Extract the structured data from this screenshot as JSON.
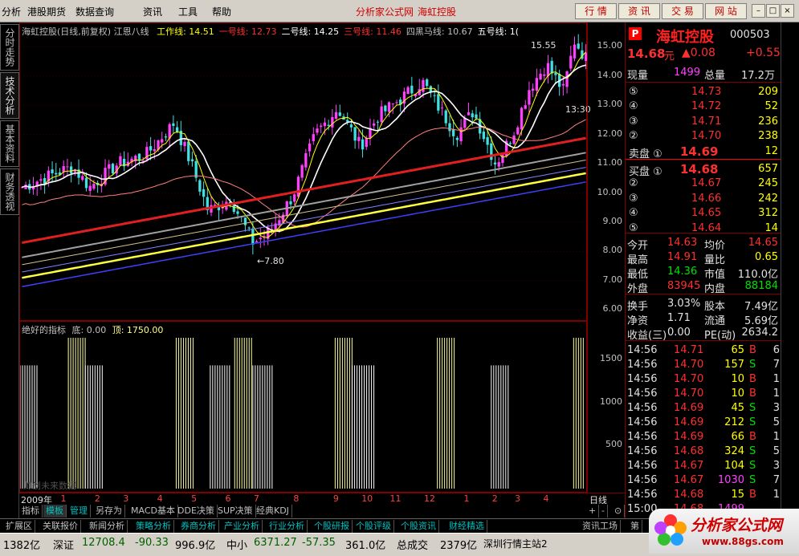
{
  "menu": {
    "items": [
      "分析",
      "港股期货",
      "数据查询",
      "资讯",
      "工具",
      "帮助"
    ],
    "title_site": "分析家公式网",
    "title_stock": "海虹控股",
    "toolbar_buttons": [
      "行 情",
      "资 讯",
      "交 易",
      "网 站"
    ],
    "window_buttons": [
      "–",
      "□",
      "×"
    ]
  },
  "left_tabs": [
    "分时走势",
    "技术分析",
    "基本资料",
    "财务透视"
  ],
  "chart": {
    "legend_title": "海虹控股(日线,前复权) 江恩八线",
    "lines": [
      {
        "name": "工作线",
        "value": "14.51",
        "color": "#ffff00"
      },
      {
        "name": "一号线",
        "value": "12.73",
        "color": "#ff3030"
      },
      {
        "name": "二号线",
        "value": "14.25",
        "color": "#ffffff"
      },
      {
        "name": "三号线",
        "value": "11.46",
        "color": "#ff3030"
      },
      {
        "name": "四黑马线",
        "value": "10.67",
        "color": "#c0c0c0"
      },
      {
        "name": "五号线",
        "value": "1(",
        "color": "#ffffff"
      }
    ],
    "annot_high": "15.55",
    "annot_low": "←7.80",
    "annot_time": "13:30",
    "y_ticks": [
      "15.00",
      "14.00",
      "13.00",
      "12.00",
      "11.00",
      "10.00",
      "9.00",
      "8.00",
      "7.00",
      "6.00"
    ],
    "y_tick_values": [
      15,
      14,
      13,
      12,
      11,
      10,
      9,
      8,
      7,
      6
    ],
    "ylim": [
      5.6,
      15.8
    ]
  },
  "indicator": {
    "title": "绝好的指标",
    "bottom_label": "底: 0.00",
    "top_label": "顶: 1750.00",
    "watermark": "帅创未来数据",
    "y_ticks": [
      "1500",
      "1000",
      "500"
    ],
    "y_tick_values": [
      1500,
      1000,
      500
    ],
    "ylim": [
      0,
      1750
    ],
    "bars": [
      {
        "start": 0.0,
        "end": 0.03,
        "value": 1430
      },
      {
        "start": 0.085,
        "end": 0.115,
        "value": 1750
      },
      {
        "start": 0.115,
        "end": 0.145,
        "value": 1430
      },
      {
        "start": 0.275,
        "end": 0.305,
        "value": 1750
      },
      {
        "start": 0.335,
        "end": 0.37,
        "value": 1430
      },
      {
        "start": 0.378,
        "end": 0.41,
        "value": 1750
      },
      {
        "start": 0.41,
        "end": 0.445,
        "value": 1430
      },
      {
        "start": 0.555,
        "end": 0.585,
        "value": 1750
      },
      {
        "start": 0.585,
        "end": 0.625,
        "value": 1430
      },
      {
        "start": 0.735,
        "end": 0.765,
        "value": 1750
      },
      {
        "start": 0.83,
        "end": 0.86,
        "value": 1430
      },
      {
        "start": 0.975,
        "end": 0.995,
        "value": 1750
      }
    ]
  },
  "date_axis": {
    "labels": [
      {
        "text": "2009年",
        "pos": 0.0
      },
      {
        "text": "1",
        "pos": 0.07
      },
      {
        "text": "2",
        "pos": 0.13
      },
      {
        "text": "3",
        "pos": 0.18
      },
      {
        "text": "4",
        "pos": 0.24
      },
      {
        "text": "5",
        "pos": 0.3
      },
      {
        "text": "6",
        "pos": 0.36
      },
      {
        "text": "7",
        "pos": 0.41
      },
      {
        "text": "8",
        "pos": 0.48
      },
      {
        "text": "9",
        "pos": 0.55
      },
      {
        "text": "10",
        "pos": 0.6
      },
      {
        "text": "11",
        "pos": 0.65
      },
      {
        "text": "12",
        "pos": 0.71
      },
      {
        "text": "1",
        "pos": 0.78
      },
      {
        "text": "2",
        "pos": 0.83
      },
      {
        "text": "3",
        "pos": 0.87
      },
      {
        "text": "4",
        "pos": 0.92
      }
    ],
    "period": "日线"
  },
  "bottom_tabs": [
    "指标",
    "模板",
    "管理",
    "另存为",
    "MACD基本",
    "DDE决策",
    "SUP决策",
    "经典KDJ"
  ],
  "bottom_controls": [
    "+",
    "-",
    "⊙"
  ],
  "shortcuts": [
    "扩展区",
    "关联报价",
    "新闻分析",
    "策略分析",
    "券商分析",
    "产业分析",
    "行业分析",
    "个股研报",
    "个股评级",
    "个股资讯",
    "财经精选",
    "资讯工场",
    "第"
  ],
  "status": {
    "vol1": "1382亿",
    "sz_label": "深证",
    "sz_index": "12708.4",
    "sz_change": "-90.33",
    "sz_amount": "996.9亿",
    "zx_label": "中小",
    "zx_index": "6371.27",
    "zx_change": "-57.35",
    "zx_amount": "361.0亿",
    "total_label": "总成交",
    "total_value": "2379亿",
    "server": "深圳行情主站2"
  },
  "quote": {
    "badge": "P",
    "name": "海虹控股",
    "code": "000503",
    "price": "14.68",
    "unit": "元",
    "change": "▲0.08",
    "change_pct": "+0.55",
    "vol_label": "现量",
    "vol_value": "1499",
    "total_vol_label": "总量",
    "total_vol_value": "17.2万",
    "asks": [
      {
        "lvl": "⑤",
        "price": "14.73",
        "vol": "209"
      },
      {
        "lvl": "④",
        "price": "14.72",
        "vol": "52"
      },
      {
        "lvl": "③",
        "price": "14.71",
        "vol": "236"
      },
      {
        "lvl": "②",
        "price": "14.70",
        "vol": "238"
      },
      {
        "lvl": "卖盘 ①",
        "price": "14.69",
        "vol": "12"
      }
    ],
    "bids": [
      {
        "lvl": "买盘 ①",
        "price": "14.68",
        "vol": "657"
      },
      {
        "lvl": "②",
        "price": "14.67",
        "vol": "245"
      },
      {
        "lvl": "③",
        "price": "14.66",
        "vol": "242"
      },
      {
        "lvl": "④",
        "price": "14.65",
        "vol": "312"
      },
      {
        "lvl": "⑤",
        "price": "14.64",
        "vol": "14"
      }
    ],
    "stats": [
      {
        "l1": "今开",
        "v1": "14.63",
        "c1": "red",
        "l2": "均价",
        "v2": "14.65",
        "c2": "red"
      },
      {
        "l1": "最高",
        "v1": "14.91",
        "c1": "red",
        "l2": "量比",
        "v2": "0.65",
        "c2": "yellow"
      },
      {
        "l1": "最低",
        "v1": "14.36",
        "c1": "green",
        "l2": "市值",
        "v2": "110.0亿",
        "c2": "white"
      },
      {
        "l1": "外盘",
        "v1": "83945",
        "c1": "red",
        "l2": "内盘",
        "v2": "88184",
        "c2": "green"
      }
    ],
    "fund": [
      {
        "l1": "换手",
        "v1": "3.03%",
        "l2": "股本",
        "v2": "7.49亿"
      },
      {
        "l1": "净资",
        "v1": "1.71",
        "l2": "流通",
        "v2": "5.69亿"
      },
      {
        "l1": "收益(三)",
        "v1": "0.00",
        "l2": "PE(动)",
        "v2": "2634.2"
      }
    ],
    "ticks": [
      {
        "t": "14:56",
        "p": "14.71",
        "v": "65",
        "bs": "B",
        "n": "6"
      },
      {
        "t": "14:56",
        "p": "14.70",
        "v": "157",
        "bs": "S",
        "n": "7"
      },
      {
        "t": "14:56",
        "p": "14.70",
        "v": "10",
        "bs": "B",
        "n": "1"
      },
      {
        "t": "14:56",
        "p": "14.70",
        "v": "10",
        "bs": "B",
        "n": "1"
      },
      {
        "t": "14:56",
        "p": "14.69",
        "v": "45",
        "bs": "S",
        "n": "3"
      },
      {
        "t": "14:56",
        "p": "14.69",
        "v": "212",
        "bs": "S",
        "n": "5"
      },
      {
        "t": "14:56",
        "p": "14.69",
        "v": "66",
        "bs": "B",
        "n": "1"
      },
      {
        "t": "14:56",
        "p": "14.68",
        "v": "324",
        "bs": "S",
        "n": "5"
      },
      {
        "t": "14:56",
        "p": "14.67",
        "v": "104",
        "bs": "S",
        "n": "3"
      },
      {
        "t": "14:56",
        "p": "14.67",
        "v": "1030",
        "bs": "S",
        "n": "7"
      },
      {
        "t": "14:56",
        "p": "14.68",
        "v": "15",
        "bs": "B",
        "n": "1"
      },
      {
        "t": "15:00",
        "p": "14.68",
        "v": "1499",
        "bs": "",
        "n": ""
      }
    ]
  },
  "watermark": {
    "brand": "分析家公式网",
    "url": "www.88gs.com"
  },
  "colors": {
    "up": "#ff3030",
    "down": "#00e000",
    "frame": "#800000",
    "candle_up": "#ff40ff",
    "candle_down": "#40e0e0"
  }
}
